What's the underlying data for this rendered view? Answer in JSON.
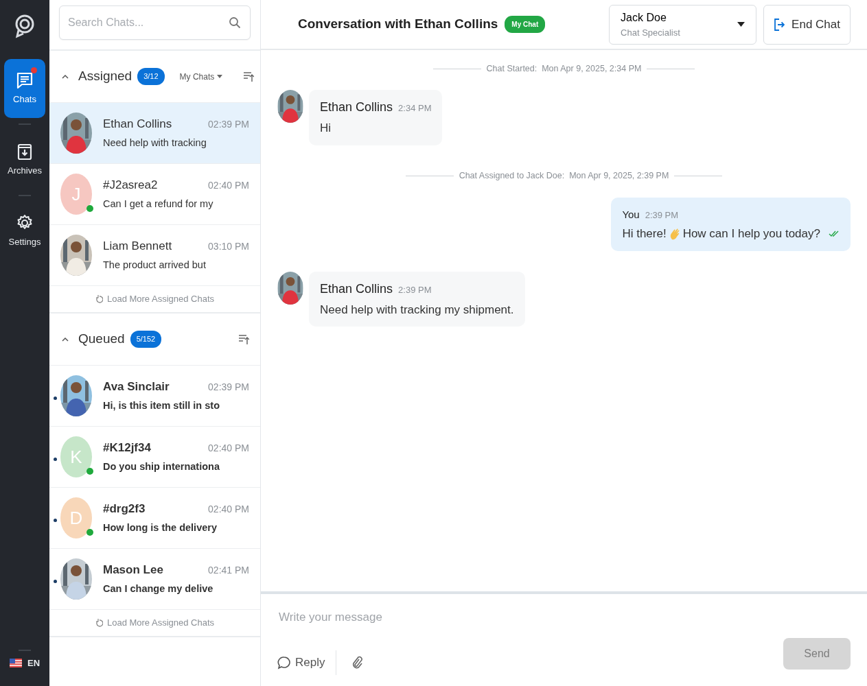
{
  "rail": {
    "items": [
      {
        "label": "Chats",
        "kind": "chats",
        "selected": true,
        "notification": true
      },
      {
        "label": "Archives",
        "kind": "archives",
        "selected": false,
        "notification": false
      },
      {
        "label": "Settings",
        "kind": "settings",
        "selected": false,
        "notification": false
      }
    ],
    "language": "EN"
  },
  "search": {
    "placeholder": "Search Chats..."
  },
  "sections": [
    {
      "title": "Assigned",
      "count": "3/12",
      "expanded": true,
      "filter": "My Chats",
      "load_more": "Load More Assigned Chats",
      "chats": [
        {
          "name": "Ethan Collins",
          "time": "02:39 PM",
          "preview": "Need help with tracking",
          "online": false,
          "unread": false,
          "selected": true
        },
        {
          "name": "#J2asrea2",
          "time": "02:40 PM",
          "preview": "Can I get a refund for my",
          "avatar": {
            "kind": "letter",
            "letter": "J",
            "color": "#f6c7c1"
          },
          "online": true,
          "unread": false,
          "selected": false
        },
        {
          "name": "Liam Bennett",
          "time": "03:10 PM",
          "preview": "The product arrived but",
          "online": false,
          "unread": false,
          "selected": false
        }
      ]
    },
    {
      "title": "Queued",
      "count": "5/152",
      "expanded": true,
      "load_more": "Load More Assigned Chats",
      "chats": [
        {
          "name": "Ava Sinclair",
          "time": "02:39 PM",
          "preview": "Hi, is this item still in sto",
          "online": false,
          "unread": true,
          "selected": false
        },
        {
          "name": "#K12jf34",
          "time": "02:40 PM",
          "preview": "Do you ship internationa",
          "avatar": {
            "kind": "letter",
            "letter": "K",
            "color": "#c6e6c9"
          },
          "online": true,
          "unread": true,
          "selected": false
        },
        {
          "name": "#drg2f3",
          "time": "02:40 PM",
          "preview": "How long is the delivery",
          "avatar": {
            "kind": "letter",
            "letter": "D",
            "color": "#f8d7b9"
          },
          "online": true,
          "unread": true,
          "selected": false
        },
        {
          "name": "Mason Lee",
          "time": "02:41 PM",
          "preview": "Can I change my delive",
          "online": false,
          "unread": true,
          "selected": false
        }
      ]
    }
  ],
  "conversation": {
    "title": "Conversation with Ethan Collins",
    "tag": "My Chat",
    "agent": {
      "name": "Jack Doe",
      "role": "Chat Specialist"
    },
    "end_button": "End Chat",
    "messages": [
      {
        "kind": "event",
        "label": "Chat Started:",
        "time": "Mon Apr 9, 2025, 2:34 PM"
      },
      {
        "kind": "incoming",
        "sender": "Ethan Collins",
        "time": "2:34 PM",
        "parts": [
          "Hi"
        ]
      },
      {
        "kind": "event",
        "label": "Chat Assigned to Jack Doe:",
        "time": "Mon Apr 9, 2025, 2:39 PM"
      },
      {
        "kind": "outgoing",
        "sender": "You",
        "time": "2:39 PM",
        "parts": [
          "Hi there!",
          "How can I help you today?"
        ],
        "read": true
      },
      {
        "kind": "incoming",
        "sender": "Ethan Collins",
        "time": "2:39 PM",
        "parts": [
          "Need help with tracking my shipment."
        ]
      }
    ]
  },
  "composer": {
    "placeholder": "Write your message",
    "reply": "Reply",
    "send": "Send",
    "send_disabled": true
  }
}
